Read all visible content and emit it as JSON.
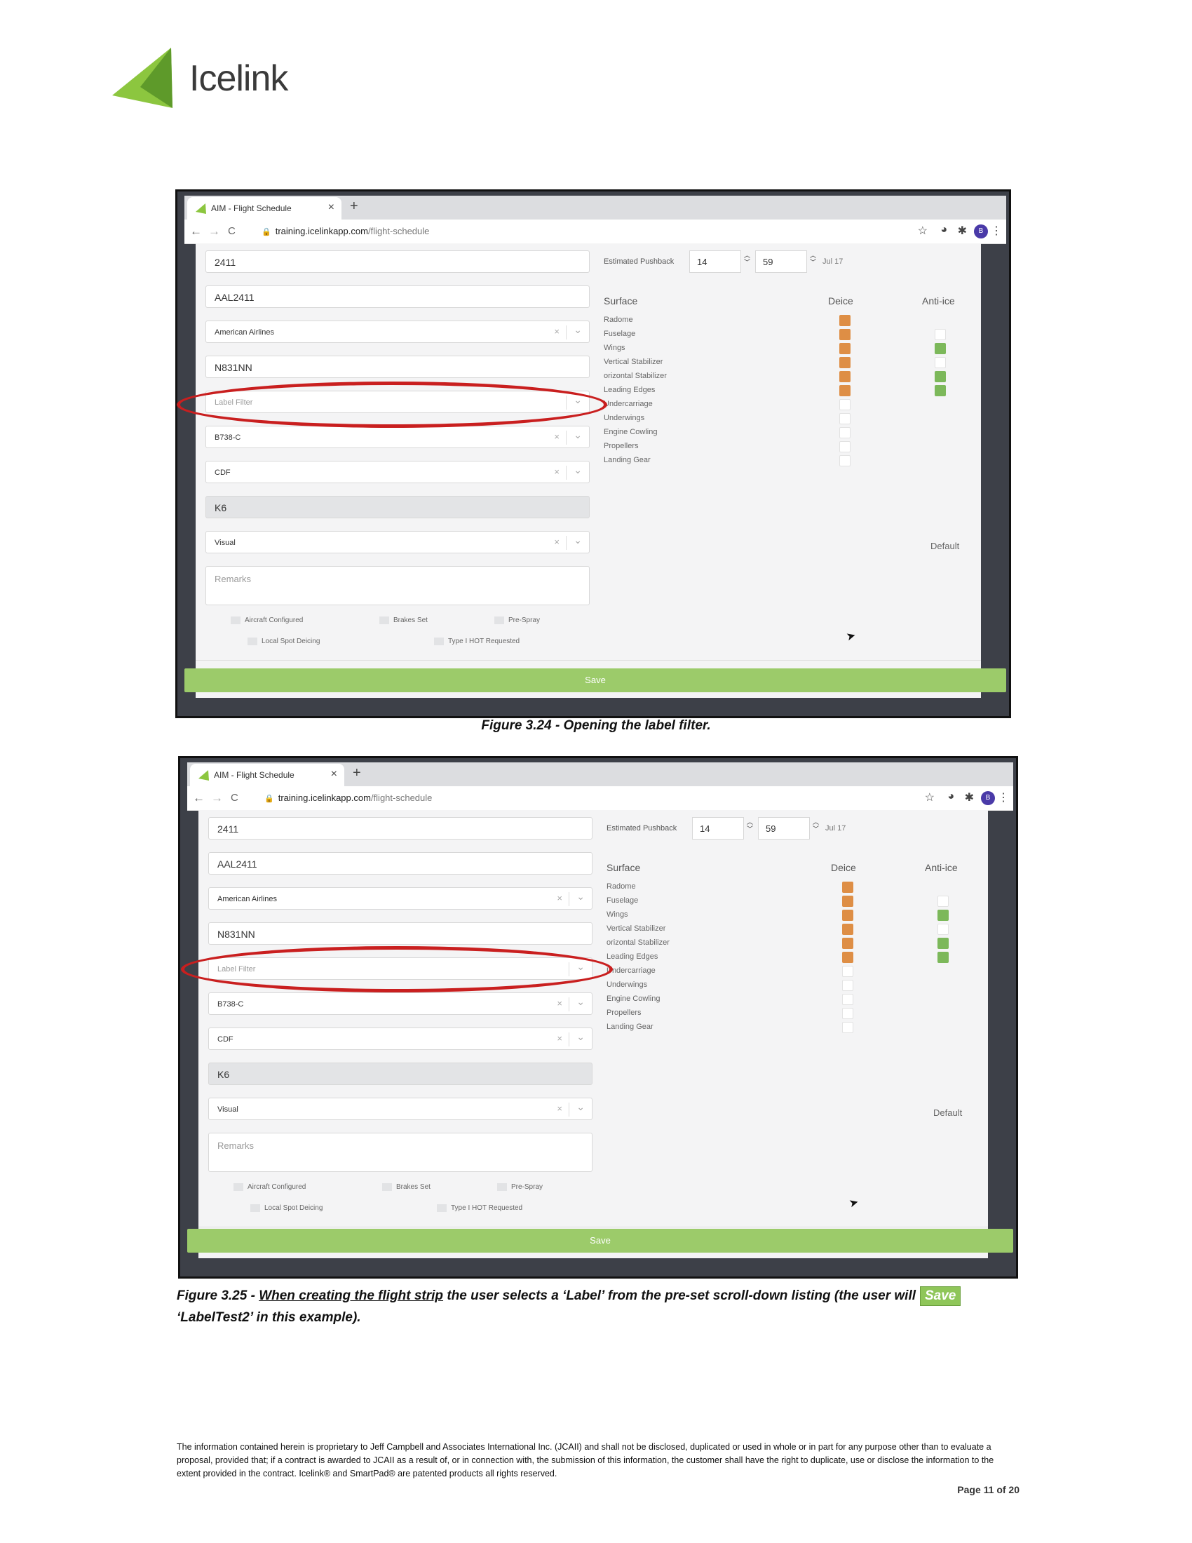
{
  "logo": {
    "text": "Icelink"
  },
  "browser": {
    "tab_title": "AIM - Flight Schedule",
    "tab_close": "×",
    "tab_new": "+",
    "nav_back": "←",
    "nav_forward": "→",
    "nav_reload": "C",
    "url_host": "training.icelinkapp.com",
    "url_path": "/flight-schedule",
    "avatar_letter": "B"
  },
  "form": {
    "flight_number": "2411",
    "call_sign": "AAL2411",
    "airline": "American Airlines",
    "tail_number": "N831NN",
    "label_filter_placeholder": "Label Filter",
    "aircraft_type": "B738-C",
    "station": "CDF",
    "pad": "K6",
    "inspection": "Visual",
    "remarks_placeholder": "Remarks",
    "clear_glyph": "×",
    "chevron_glyph": "⌄",
    "checkboxes_row1": [
      "Aircraft Configured",
      "Brakes Set",
      "Pre-Spray"
    ],
    "checkboxes_row2": [
      "Local Spot Deicing",
      "Type I HOT Requested"
    ],
    "save_label": "Save"
  },
  "pushback": {
    "label": "Estimated Pushback",
    "hour": "14",
    "minute": "59",
    "date": "Jul 17"
  },
  "surfaces": {
    "header_surface": "Surface",
    "header_deice": "Deice",
    "header_antiice": "Anti-ice",
    "default_label": "Default",
    "rows": [
      {
        "name": "Radome",
        "deice": "orange",
        "antiice": "none"
      },
      {
        "name": "Fuselage",
        "deice": "orange",
        "antiice": "empty"
      },
      {
        "name": "Wings",
        "deice": "orange",
        "antiice": "green"
      },
      {
        "name": "Vertical Stabilizer",
        "deice": "orange",
        "antiice": "empty"
      },
      {
        "name": "orizontal Stabilizer",
        "deice": "orange",
        "antiice": "green"
      },
      {
        "name": "Leading Edges",
        "deice": "orange",
        "antiice": "green"
      },
      {
        "name": "Undercarriage",
        "deice": "empty",
        "antiice": "none"
      },
      {
        "name": "Underwings",
        "deice": "empty",
        "antiice": "none"
      },
      {
        "name": "Engine Cowling",
        "deice": "empty",
        "antiice": "none"
      },
      {
        "name": "Propellers",
        "deice": "empty",
        "antiice": "none"
      },
      {
        "name": "Landing Gear",
        "deice": "empty",
        "antiice": "none"
      }
    ]
  },
  "captions": {
    "fig1": "Figure 3.24 - Opening the label filter.",
    "fig2_prefix": "Figure 3.25 - ",
    "fig2_underlined": "When creating the flight strip",
    "fig2_middle": " the user selects a ‘Label’ from the pre-set scroll-down listing (the user will",
    "fig2_chip": "Save",
    "fig2_end": "‘LabelTest2’ in this example)."
  },
  "footer": {
    "disclaimer": "The information contained herein is proprietary to Jeff Campbell and Associates International Inc. (JCAII) and shall not be disclosed, duplicated or used in whole or in part for any purpose other than to evaluate a proposal, provided that; if a contract is awarded to JCAII as a result of, or in connection with, the submission of this information, the customer shall have the right to duplicate, use or disclose the information to the extent provided in the contract. Icelink® and SmartPad® are patented products all rights reserved.",
    "page": "Page 11 of 20"
  }
}
